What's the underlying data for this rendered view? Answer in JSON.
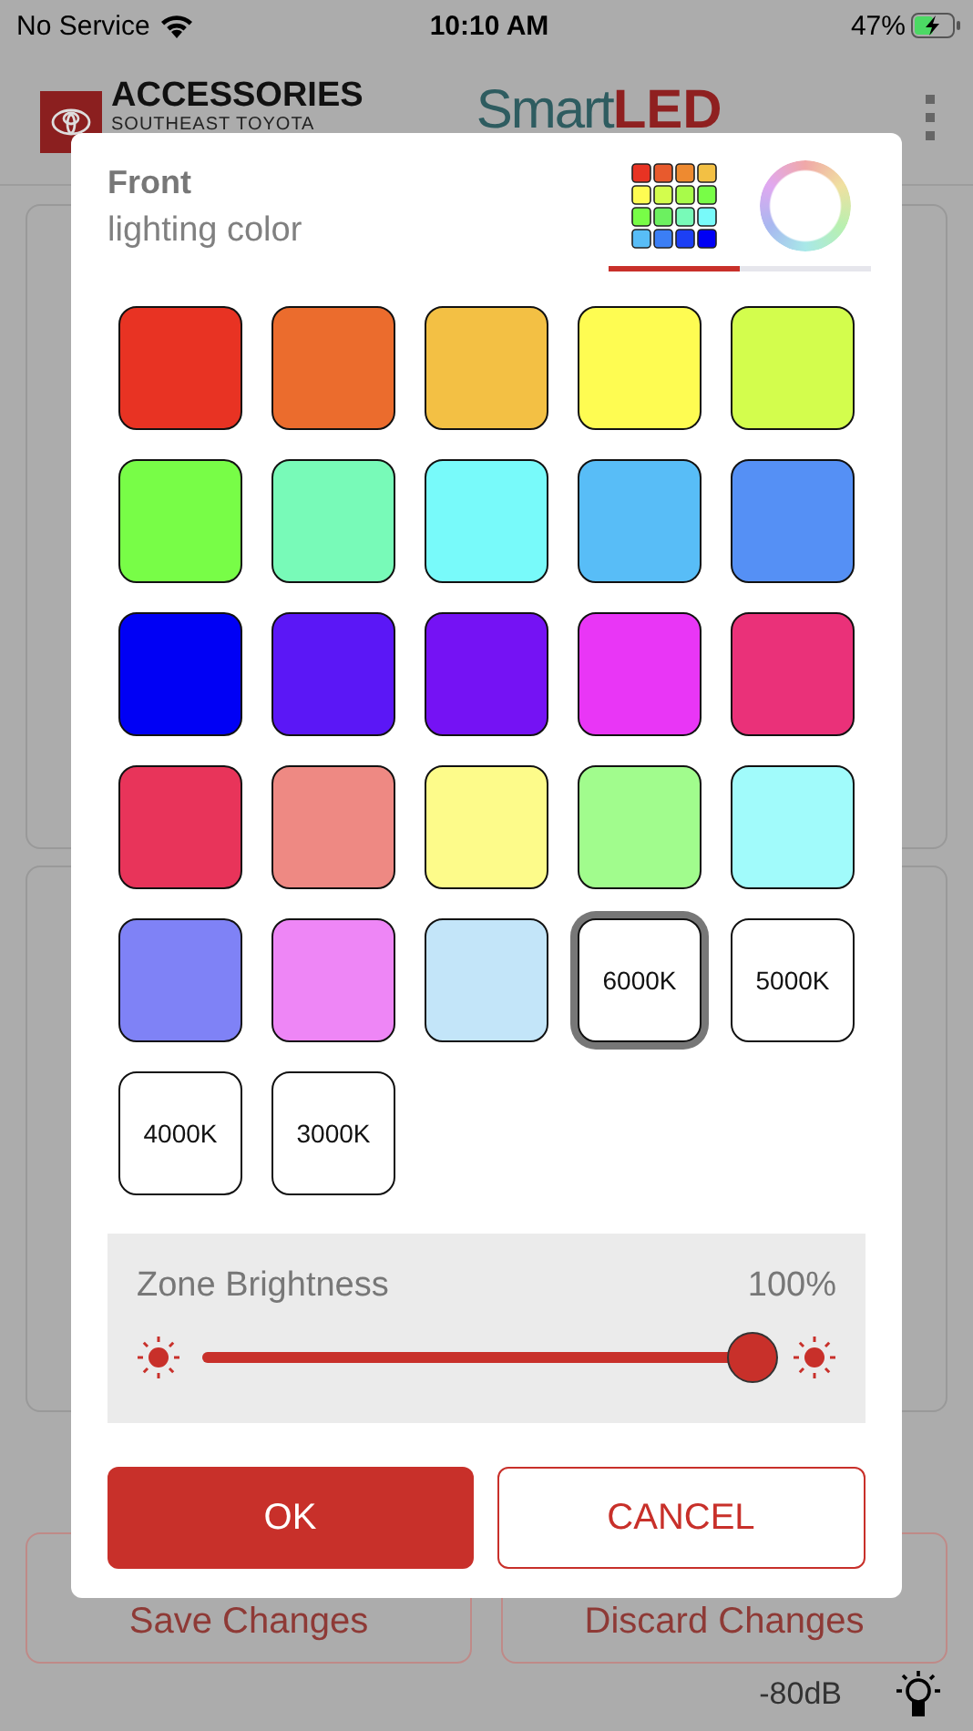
{
  "status_bar": {
    "carrier": "No Service",
    "time": "10:10 AM",
    "battery": "47%"
  },
  "header": {
    "brand": "ACCESSORIES",
    "brand_sub": "SOUTHEAST TOYOTA",
    "app_title": {
      "light": "Smart",
      "bold": "LED"
    }
  },
  "background": {
    "buttons": [
      "Save Changes",
      "Discard Changes"
    ],
    "signal": "-80dB"
  },
  "dialog": {
    "title": "Front",
    "subtitle": "lighting color",
    "tabs": [
      {
        "kind": "swatches",
        "selected": true
      },
      {
        "kind": "wheel",
        "selected": false
      }
    ],
    "swatches": [
      {
        "kind": "color",
        "color": "#e83323",
        "selected": false
      },
      {
        "kind": "color",
        "color": "#eb6c2d",
        "selected": false
      },
      {
        "kind": "color",
        "color": "#f3c044",
        "selected": false
      },
      {
        "kind": "color",
        "color": "#fefc52",
        "selected": false
      },
      {
        "kind": "color",
        "color": "#d3fd4d",
        "selected": false
      },
      {
        "kind": "color",
        "color": "#78fd47",
        "selected": false
      },
      {
        "kind": "color",
        "color": "#78fab8",
        "selected": false
      },
      {
        "kind": "color",
        "color": "#78fafa",
        "selected": false
      },
      {
        "kind": "color",
        "color": "#58bdf7",
        "selected": false
      },
      {
        "kind": "color",
        "color": "#5590f5",
        "selected": false
      },
      {
        "kind": "color",
        "color": "#0000f5",
        "selected": false
      },
      {
        "kind": "color",
        "color": "#5b17f6",
        "selected": false
      },
      {
        "kind": "color",
        "color": "#7512f4",
        "selected": false
      },
      {
        "kind": "color",
        "color": "#e936f6",
        "selected": false
      },
      {
        "kind": "color",
        "color": "#ea3179",
        "selected": false
      },
      {
        "kind": "color",
        "color": "#e8345a",
        "selected": false
      },
      {
        "kind": "color",
        "color": "#ee8983",
        "selected": false
      },
      {
        "kind": "color",
        "color": "#fdfb8a",
        "selected": false
      },
      {
        "kind": "color",
        "color": "#a1fc8d",
        "selected": false
      },
      {
        "kind": "color",
        "color": "#a1fbfb",
        "selected": false
      },
      {
        "kind": "color",
        "color": "#7f82f6",
        "selected": false
      },
      {
        "kind": "color",
        "color": "#ee86f6",
        "selected": false
      },
      {
        "kind": "color",
        "color": "#c3e5f9",
        "selected": false
      },
      {
        "kind": "white",
        "label": "6000K",
        "selected": true
      },
      {
        "kind": "white",
        "label": "5000K",
        "selected": false
      },
      {
        "kind": "white",
        "label": "4000K",
        "selected": false
      },
      {
        "kind": "white",
        "label": "3000K",
        "selected": false
      }
    ],
    "brightness": {
      "label": "Zone Brightness",
      "reading": "100%",
      "level": 1
    },
    "buttons": [
      {
        "kind": "primary",
        "label": "OK"
      },
      {
        "kind": "secondary",
        "label": "CANCEL"
      }
    ]
  }
}
